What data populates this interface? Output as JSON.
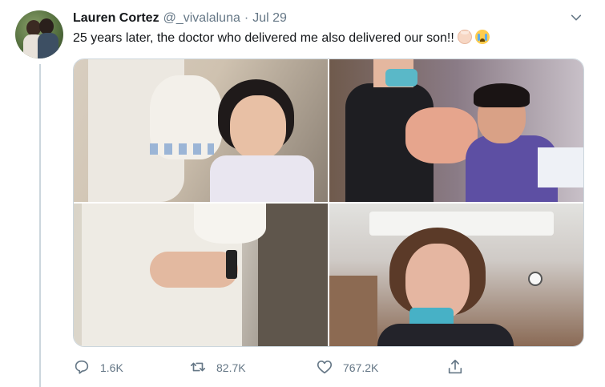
{
  "tweet": {
    "author_name": "Lauren Cortez",
    "handle": "@_vivalaluna",
    "separator": "·",
    "date": "Jul 29",
    "text": "25 years later, the doctor who delivered me also delivered our son!!",
    "emojis": [
      "baby-emoji",
      "crying-face-emoji"
    ],
    "media_count": 4
  },
  "actions": {
    "reply_count": "1.6K",
    "retweet_count": "82.7K",
    "like_count": "767.2K"
  },
  "icons": [
    "caret-down-icon",
    "reply-icon",
    "retweet-icon",
    "like-icon",
    "share-icon"
  ],
  "colors": {
    "text_primary": "#14171a",
    "text_secondary": "#657786",
    "border": "#ccd6dd"
  }
}
